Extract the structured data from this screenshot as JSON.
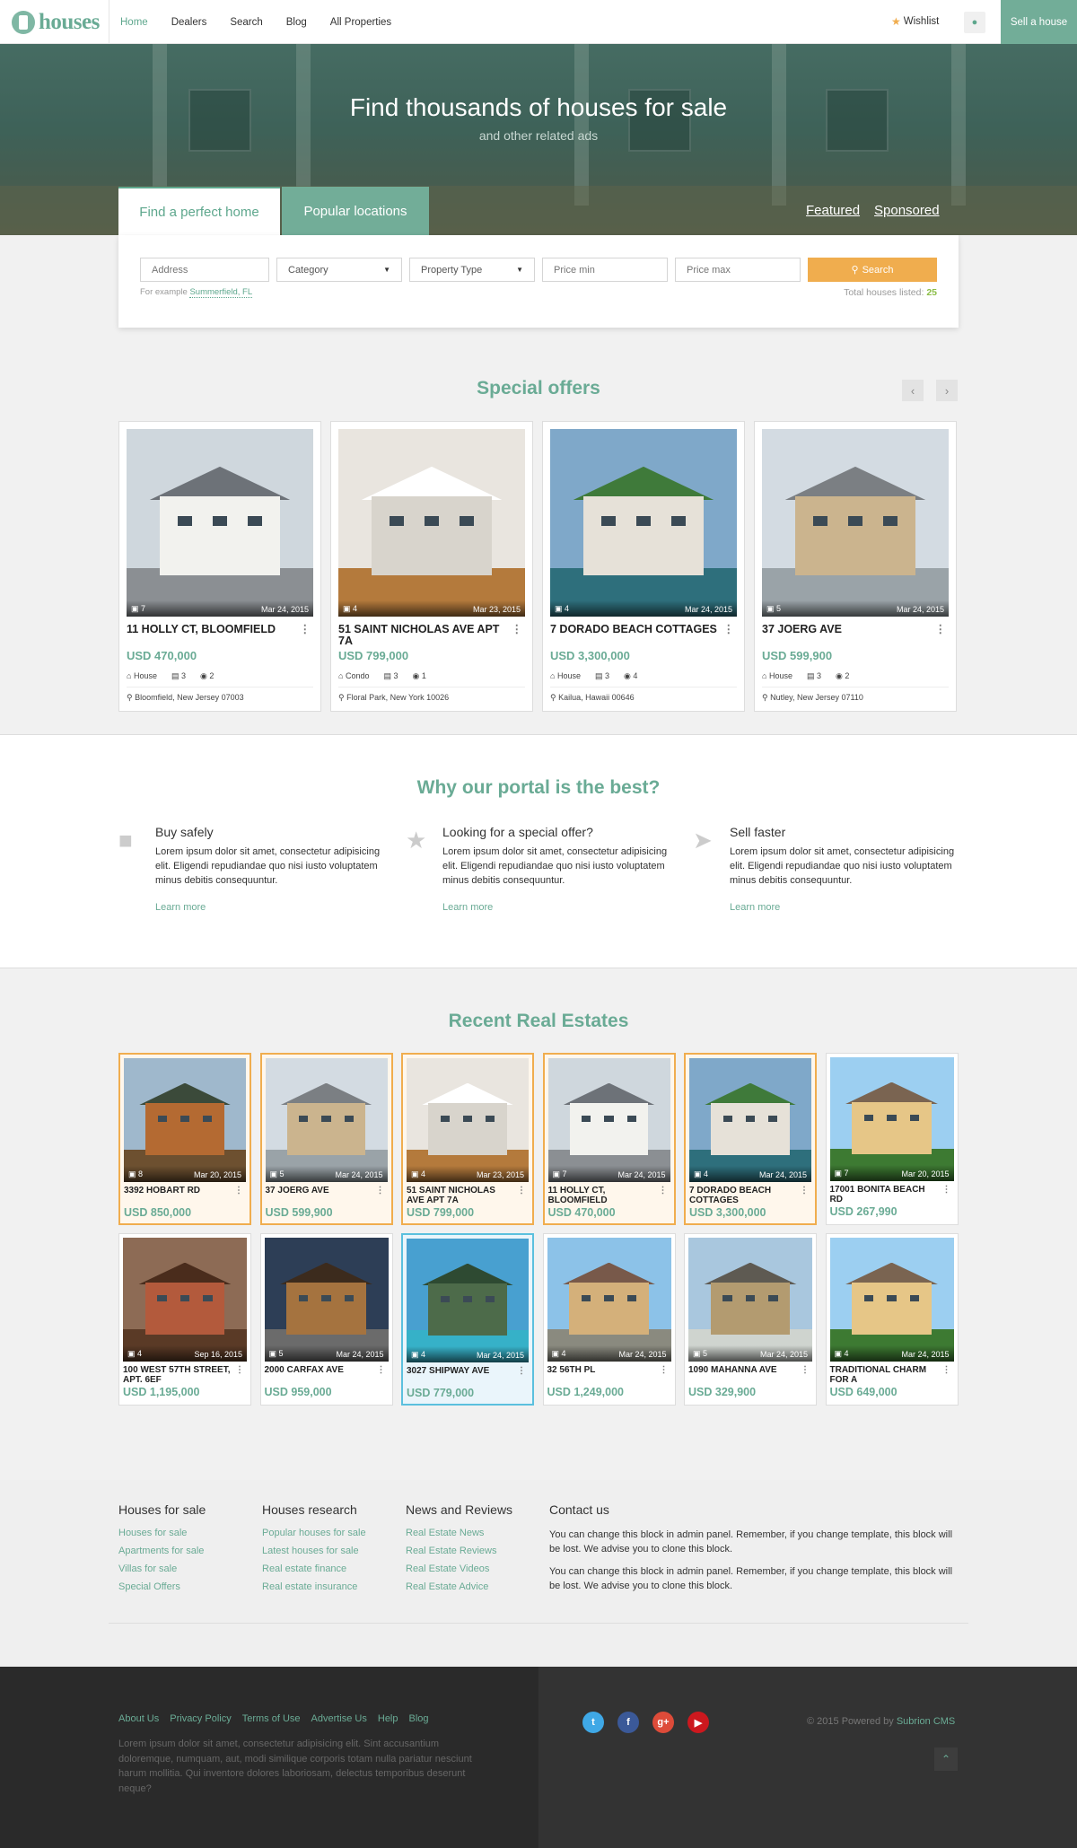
{
  "nav": {
    "logo_text": "houses",
    "links": [
      "Home",
      "Dealers",
      "Search",
      "Blog",
      "All Properties"
    ],
    "wishlist": "Wishlist",
    "sell": "Sell a house"
  },
  "hero": {
    "title": "Find thousands of houses for sale",
    "subtitle": "and other related ads"
  },
  "search": {
    "tab_find": "Find a perfect home",
    "tab_popular": "Popular locations",
    "link_featured": "Featured",
    "link_sponsored": "Sponsored",
    "address_placeholder": "Address",
    "category": "Category",
    "property_type": "Property Type",
    "price_min_placeholder": "Price min",
    "price_max_placeholder": "Price max",
    "button": "Search",
    "example_prefix": "For example",
    "example_link": "Summerfield, FL",
    "total_label": "Total houses listed:",
    "total_count": "25"
  },
  "offers": {
    "title": "Special offers",
    "items": [
      {
        "photos": "7",
        "date": "Mar 24, 2015",
        "title": "11 HOLLY CT, BLOOMFIELD",
        "price": "USD 470,000",
        "type": "House",
        "beds": "3",
        "baths": "2",
        "location": "Bloomfield, New Jersey 07003"
      },
      {
        "photos": "4",
        "date": "Mar 23, 2015",
        "title": "51 SAINT NICHOLAS AVE APT 7A",
        "price": "USD 799,000",
        "type": "Condo",
        "beds": "3",
        "baths": "1",
        "location": "Floral Park, New York 10026"
      },
      {
        "photos": "4",
        "date": "Mar 24, 2015",
        "title": "7 DORADO BEACH COTTAGES",
        "price": "USD 3,300,000",
        "type": "House",
        "beds": "3",
        "baths": "4",
        "location": "Kailua, Hawaii 00646"
      },
      {
        "photos": "5",
        "date": "Mar 24, 2015",
        "title": "37 JOERG AVE",
        "price": "USD 599,900",
        "type": "House",
        "beds": "3",
        "baths": "2",
        "location": "Nutley, New Jersey 07110"
      }
    ]
  },
  "why": {
    "title": "Why our portal is the best?",
    "features": [
      {
        "icon": "lock-icon",
        "title": "Buy safely",
        "text": "Lorem ipsum dolor sit amet, consectetur adipisicing elit. Eligendi repudiandae quo nisi iusto voluptatem minus debitis consequuntur.",
        "link": "Learn more"
      },
      {
        "icon": "star-icon",
        "title": "Looking for a special offer?",
        "text": "Lorem ipsum dolor sit amet, consectetur adipisicing elit. Eligendi repudiandae quo nisi iusto voluptatem minus debitis consequuntur.",
        "link": "Learn more"
      },
      {
        "icon": "rocket-icon",
        "title": "Sell faster",
        "text": "Lorem ipsum dolor sit amet, consectetur adipisicing elit. Eligendi repudiandae quo nisi iusto voluptatem minus debitis consequuntur.",
        "link": "Learn more"
      }
    ]
  },
  "recent": {
    "title": "Recent Real Estates",
    "items": [
      {
        "photos": "8",
        "date": "Mar 20, 2015",
        "title": "3392 HOBART RD",
        "price": "USD 850,000"
      },
      {
        "photos": "5",
        "date": "Mar 24, 2015",
        "title": "37 JOERG AVE",
        "price": "USD 599,900"
      },
      {
        "photos": "4",
        "date": "Mar 23, 2015",
        "title": "51 SAINT NICHOLAS AVE APT 7A",
        "price": "USD 799,000"
      },
      {
        "photos": "7",
        "date": "Mar 24, 2015",
        "title": "11 HOLLY CT, BLOOMFIELD",
        "price": "USD 470,000"
      },
      {
        "photos": "4",
        "date": "Mar 24, 2015",
        "title": "7 DORADO BEACH COTTAGES",
        "price": "USD 3,300,000"
      },
      {
        "photos": "7",
        "date": "Mar 20, 2015",
        "title": "17001 BONITA BEACH RD",
        "price": "USD 267,990"
      },
      {
        "photos": "4",
        "date": "Sep 16, 2015",
        "title": "100 WEST 57TH STREET, APT. 6EF",
        "price": "USD 1,195,000"
      },
      {
        "photos": "5",
        "date": "Mar 24, 2015",
        "title": "2000 CARFAX AVE",
        "price": "USD 959,000"
      },
      {
        "photos": "4",
        "date": "Mar 24, 2015",
        "title": "3027 SHIPWAY AVE",
        "price": "USD 779,000"
      },
      {
        "photos": "4",
        "date": "Mar 24, 2015",
        "title": "32 56TH PL",
        "price": "USD 1,249,000"
      },
      {
        "photos": "5",
        "date": "Mar 24, 2015",
        "title": "1090 MAHANNA AVE",
        "price": "USD 329,900"
      },
      {
        "photos": "4",
        "date": "Mar 24, 2015",
        "title": "TRADITIONAL CHARM FOR A",
        "price": "USD 649,000"
      }
    ]
  },
  "footer": {
    "col1": {
      "title": "Houses for sale",
      "links": [
        "Houses for sale",
        "Apartments for sale",
        "Villas for sale",
        "Special Offers"
      ]
    },
    "col2": {
      "title": "Houses research",
      "links": [
        "Popular houses for sale",
        "Latest houses for sale",
        "Real estate finance",
        "Real estate insurance"
      ]
    },
    "col3": {
      "title": "News and Reviews",
      "links": [
        "Real Estate News",
        "Real Estate Reviews",
        "Real Estate Videos",
        "Real Estate Advice"
      ]
    },
    "contact": {
      "title": "Contact us",
      "p1": "You can change this block in admin panel. Remember, if you change template, this block will be lost. We advise you to clone this block.",
      "p2": "You can change this block in admin panel. Remember, if you change template, this block will be lost. We advise you to clone this block."
    },
    "bottom_links": [
      "About Us",
      "Privacy Policy",
      "Terms of Use",
      "Advertise Us",
      "Help",
      "Blog"
    ],
    "bottom_text": "Lorem ipsum dolor sit amet, consectetur adipisicing elit. Sint accusantium doloremque, numquam, aut, modi similique corporis totam nulla pariatur nesciunt harum mollitia. Qui inventore dolores laboriosam, delectus temporibus deserunt neque?",
    "copyright": "© 2015 Powered by",
    "brand": "Subrion CMS",
    "social": [
      "twitter-icon",
      "facebook-icon",
      "google-plus-icon",
      "youtube-icon"
    ]
  },
  "colors": {
    "accent": "#6aab95",
    "orange": "#f0ad4e",
    "highlight_blue": "#5bc0de"
  }
}
